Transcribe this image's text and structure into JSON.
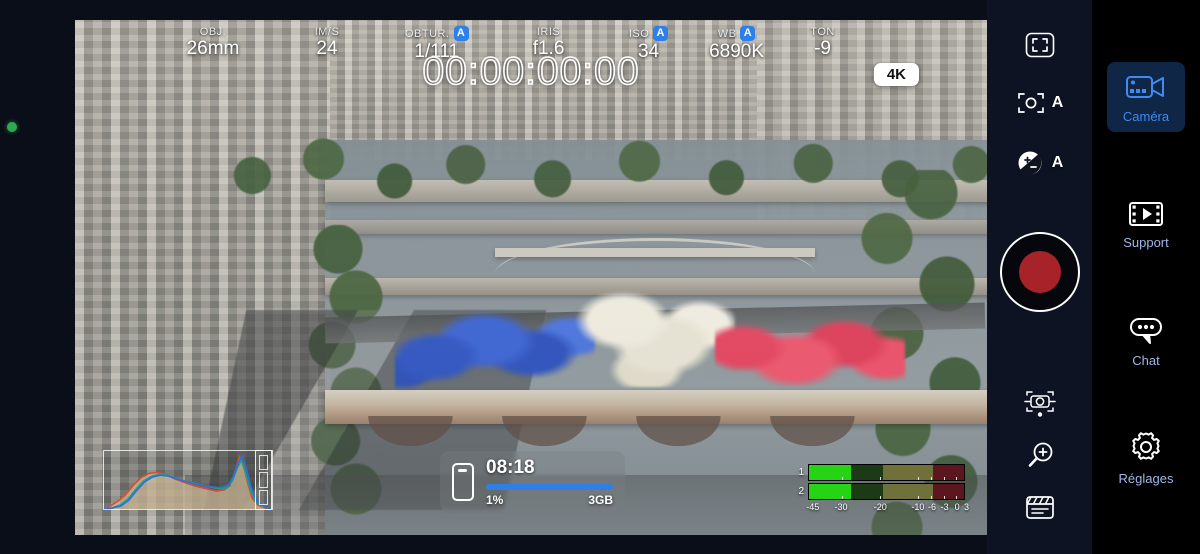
{
  "app": {
    "mode": "video-camera-hud",
    "accent_blue": "#2f7fe8",
    "record_red": "#a8222a"
  },
  "hud": {
    "settings": [
      {
        "label": "OBJ.",
        "value": "26mm",
        "auto": false,
        "icon": "lens-icon"
      },
      {
        "label": "IM/S",
        "value": "24",
        "auto": false,
        "icon": "framerate-icon"
      },
      {
        "label": "OBTUR.",
        "value": "1/111",
        "auto": true,
        "icon": "shutter-icon"
      },
      {
        "label": "IRIS",
        "value": "f1.6",
        "auto": false,
        "icon": "aperture-icon"
      },
      {
        "label": "ISO",
        "value": "34",
        "auto": true,
        "icon": "iso-icon"
      },
      {
        "label": "WB",
        "value": "6890K",
        "auto": true,
        "icon": "whitebalance-icon"
      },
      {
        "label": "TON",
        "value": "-9",
        "auto": false,
        "icon": "tint-icon"
      }
    ],
    "timecode": "00:00:00:00",
    "resolution_badge": "4K",
    "auto_badge_letter": "A",
    "status_dot_color": "#2fa84f"
  },
  "battery_widget": {
    "icon": "phone-icon",
    "time_remaining": "08:18",
    "percent_label": "1%",
    "storage_label": "3GB",
    "bar_fill_percent": 100,
    "bar_color": "#2f7fe8"
  },
  "histogram": {
    "name": "rgb-histogram",
    "channels": [
      "red",
      "green",
      "blue"
    ],
    "ire_segments": 3
  },
  "audio_meters": {
    "channels": [
      {
        "label": "1",
        "level_percent": 27
      },
      {
        "label": "2",
        "level_percent": 27
      }
    ],
    "scale": [
      "-45",
      "-30",
      "-20",
      "-10",
      "-6",
      "-3",
      "0",
      "3"
    ],
    "scale_positions": [
      3,
      21,
      46,
      70,
      79,
      87,
      95,
      100
    ],
    "zone_colors": {
      "safe": "#1c3a16",
      "caution": "#70703a",
      "peak": "#5c1620",
      "fill": "#27d315"
    }
  },
  "rail": {
    "buttons": [
      {
        "name": "framing-guides-icon",
        "label": "",
        "auto": ""
      },
      {
        "name": "focus-icon",
        "label": "",
        "auto": "A"
      },
      {
        "name": "exposure-comp-icon",
        "label": "",
        "auto": "A"
      },
      {
        "name": "camera-frame-icon",
        "label": "",
        "auto": ""
      },
      {
        "name": "zoom-in-icon",
        "label": "",
        "auto": ""
      },
      {
        "name": "clapperboard-icon",
        "label": "",
        "auto": ""
      }
    ],
    "record_button": {
      "name": "record-button",
      "recording": false
    }
  },
  "menu": {
    "items": [
      {
        "id": "camera",
        "label": "Caméra",
        "icon": "camcorder-icon",
        "active": true
      },
      {
        "id": "support",
        "label": "Support",
        "icon": "filmstrip-icon",
        "active": false
      },
      {
        "id": "chat",
        "label": "Chat",
        "icon": "chat-bubble-icon",
        "active": false
      },
      {
        "id": "settings",
        "label": "Réglages",
        "icon": "gear-icon",
        "active": false
      }
    ]
  }
}
